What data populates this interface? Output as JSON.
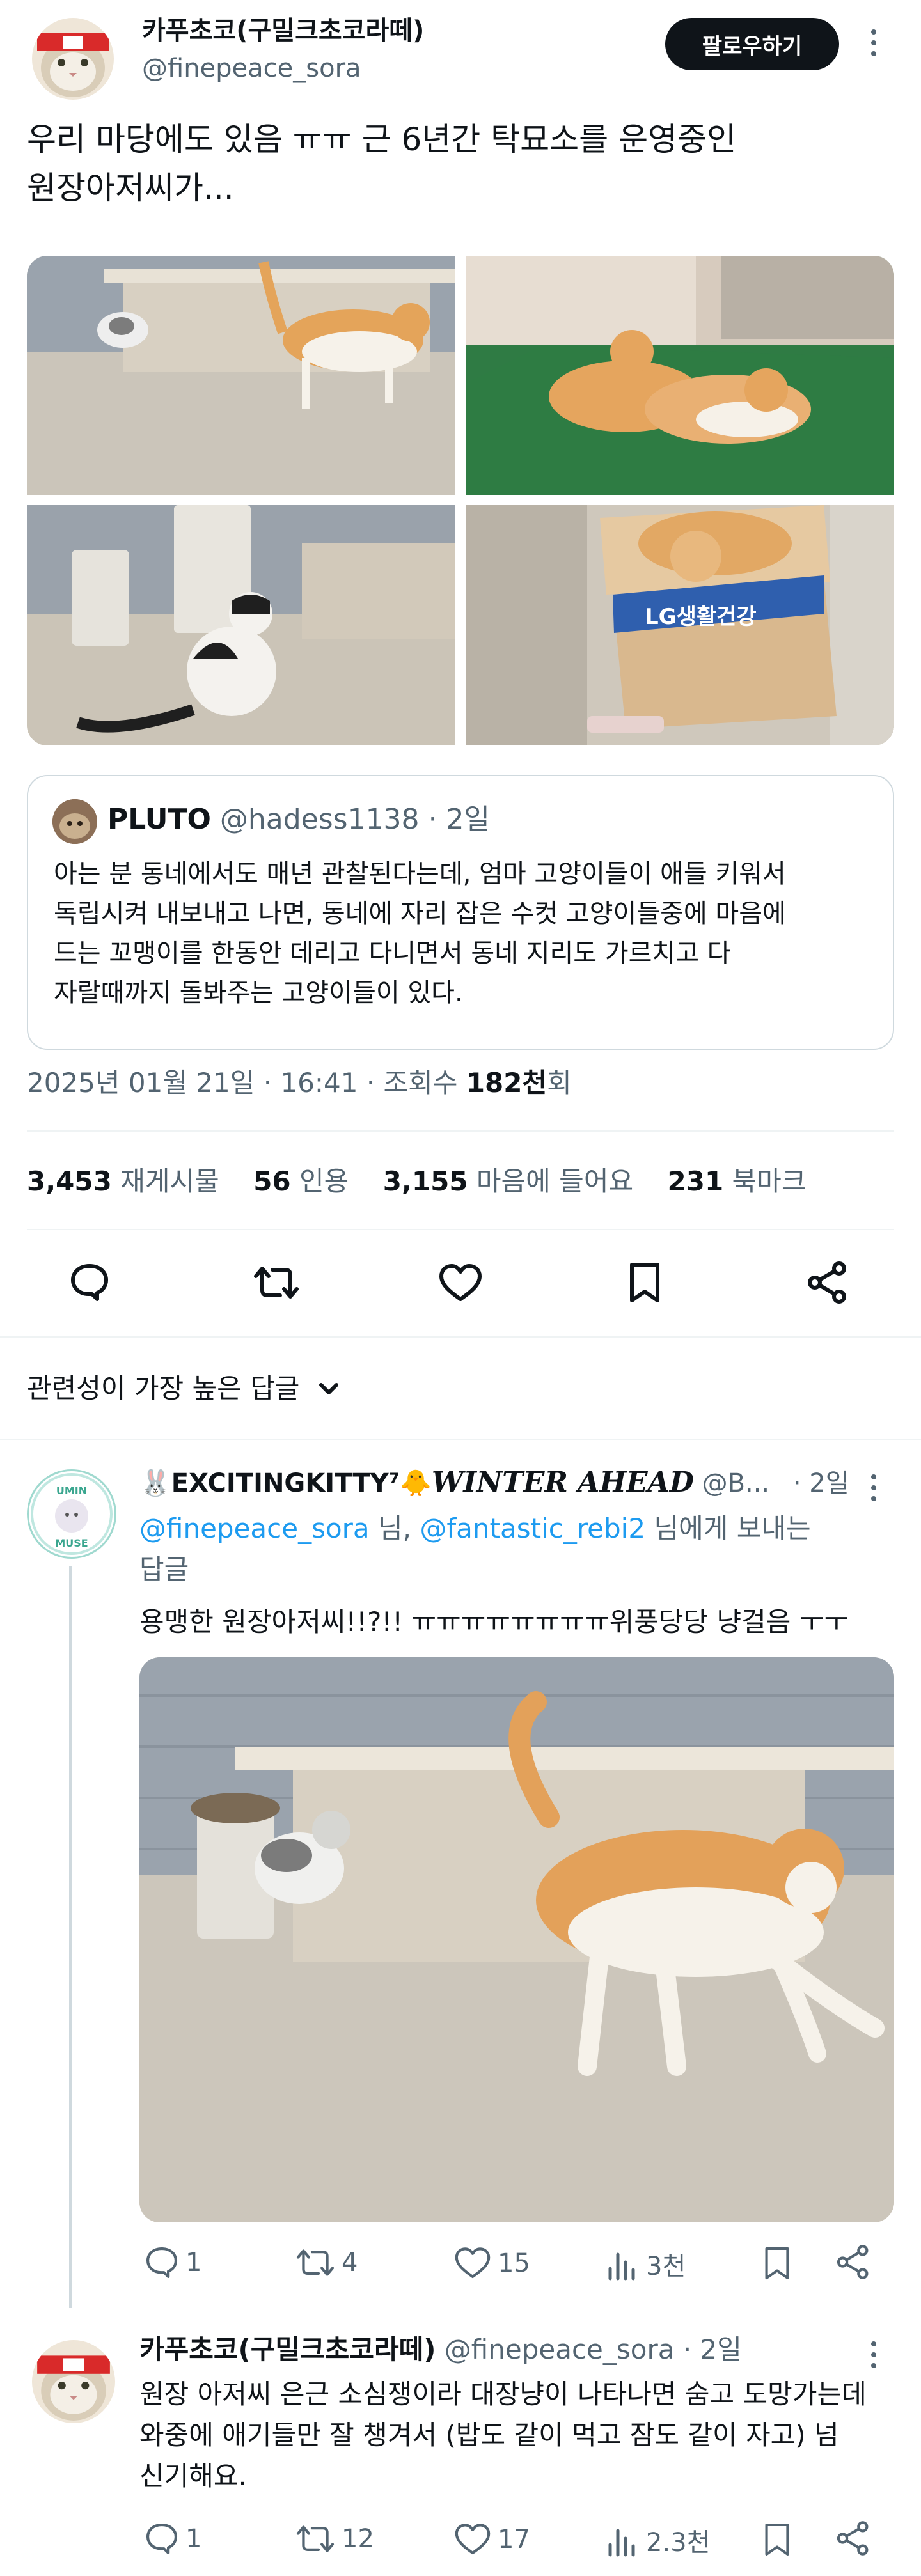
{
  "post": {
    "author_name": "카푸초코(구밀크초코라떼)",
    "author_handle": "@finepeace_sora",
    "follow_label": "팔로우하기",
    "text_line1": "우리 마당에도 있음 ㅠㅠ 근 6년간 탁묘소를 운영중인",
    "text_line2": "원장아저씨가...",
    "box_label": "LG생활건강",
    "quote": {
      "author_name": "PLUTO",
      "author_handle": "@hadess1138",
      "time": "· 2일",
      "line1": "아는 분 동네에서도 매년 관찰된다는데, 엄마 고양이들이 애들 키워서",
      "line2": "독립시켜 내보내고 나면, 동네에 자리 잡은 수컷 고양이들중에 마음에",
      "line3": "드는 꼬맹이를 한동안 데리고 다니면서 동네 지리도 가르치고 다",
      "line4": "자랄때까지 돌봐주는 고양이들이 있다."
    },
    "timestamp": "2025년 01월 21일 · 16:41 · 조회수 ",
    "views_bold": "182천",
    "views_suffix": "회",
    "metrics": {
      "reposts_num": "3,453",
      "reposts_label": "재게시물",
      "quotes_num": "56",
      "quotes_label": "인용",
      "likes_num": "3,155",
      "likes_label": "마음에 들어요",
      "bookmarks_num": "231",
      "bookmarks_label": "북마크"
    }
  },
  "replies_sort_label": "관련성이 가장 높은 답글",
  "reply1": {
    "avatar_text_top": "UMIN",
    "avatar_text_bottom": "MUSE",
    "name_prefix": "🐰EXCITINGKITTY⁷🐥",
    "name_suffix": "WINTER AHEAD",
    "handle": "@B...",
    "time": "· 2일",
    "to_user1": "@finepeace_sora",
    "to_mid": " 님, ",
    "to_user2": "@fantastic_rebi2",
    "to_end": " 님에게 보내는",
    "to_line2": "답글",
    "text": "용맹한 원장아저씨!!?!! ㅠㅠㅠㅠㅠㅠㅠㅠ위풍당당 냥걸음 ㅜㅜ",
    "replies": "1",
    "reposts": "4",
    "likes": "15",
    "views": "3천"
  },
  "reply2": {
    "name": "카푸초코(구밀크초코라떼)",
    "handle": "@finepeace_sora",
    "time": "· 2일",
    "line1": "원장 아저씨 은근 소심쟁이라 대장냥이 나타나면 숨고 도망가는데",
    "line2": "와중에 애기들만 잘 챙겨서 (밥도 같이 먹고 잠도 같이 자고) 넘",
    "line3": "신기해요.",
    "replies": "1",
    "reposts": "12",
    "likes": "17",
    "views": "2.3천"
  },
  "icons": {
    "reply": "speech-bubble-icon",
    "repost": "repost-arrows-icon",
    "like": "heart-icon",
    "views": "bar-chart-icon",
    "bookmark": "bookmark-icon",
    "share": "share-icon",
    "more": "more-vertical-icon",
    "chevron": "chevron-down-icon"
  },
  "colors": {
    "accent": "#1d9bf0",
    "text": "#0f1419",
    "muted": "#536471",
    "follow_bg": "#0f1419"
  }
}
